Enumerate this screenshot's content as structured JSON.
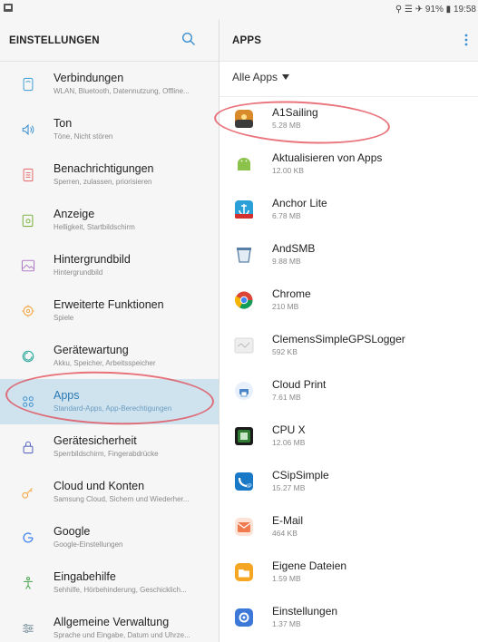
{
  "status_bar": {
    "text": "⚲ ☰ ✈ 91% ▮ 19:58"
  },
  "left_pane": {
    "title": "EINSTELLUNGEN",
    "items": [
      {
        "title": "Verbindungen",
        "subtitle": "WLAN, Bluetooth, Datennutzung, Offline...",
        "icon": "connections-icon"
      },
      {
        "title": "Ton",
        "subtitle": "Töne, Nicht stören",
        "icon": "sound-icon"
      },
      {
        "title": "Benachrichtigungen",
        "subtitle": "Sperren, zulassen, priorisieren",
        "icon": "notifications-icon"
      },
      {
        "title": "Anzeige",
        "subtitle": "Helligkeit, Startbildschirm",
        "icon": "display-icon"
      },
      {
        "title": "Hintergrundbild",
        "subtitle": "Hintergrundbild",
        "icon": "wallpaper-icon"
      },
      {
        "title": "Erweiterte Funktionen",
        "subtitle": "Spiele",
        "icon": "advanced-features-icon"
      },
      {
        "title": "Gerätewartung",
        "subtitle": "Akku, Speicher, Arbeitsspeicher",
        "icon": "device-maintenance-icon"
      },
      {
        "title": "Apps",
        "subtitle": "Standard-Apps, App-Berechtigungen",
        "icon": "apps-icon",
        "selected": true
      },
      {
        "title": "Gerätesicherheit",
        "subtitle": "Sperrbildschirm, Fingerabdrücke",
        "icon": "lock-icon"
      },
      {
        "title": "Cloud und Konten",
        "subtitle": "Samsung Cloud, Sichern und Wiederher...",
        "icon": "key-icon"
      },
      {
        "title": "Google",
        "subtitle": "Google-Einstellungen",
        "icon": "google-icon"
      },
      {
        "title": "Eingabehilfe",
        "subtitle": "Sehhilfe, Hörbehinderung, Geschicklich...",
        "icon": "accessibility-icon"
      },
      {
        "title": "Allgemeine Verwaltung",
        "subtitle": "Sprache und Eingabe, Datum und Uhrze...",
        "icon": "general-management-icon"
      }
    ]
  },
  "right_pane": {
    "title": "APPS",
    "filter_label": "Alle Apps",
    "apps": [
      {
        "name": "A1Sailing",
        "size": "5.28 MB",
        "icon": "a1sailing-icon",
        "color": "#d98a2b"
      },
      {
        "name": "Aktualisieren von Apps",
        "size": "12.00 KB",
        "icon": "android-icon",
        "color": "#8bc34a"
      },
      {
        "name": "Anchor Lite",
        "size": "6.78 MB",
        "icon": "anchor-icon",
        "color": "#2a9fd8"
      },
      {
        "name": "AndSMB",
        "size": "9.88 MB",
        "icon": "andsmb-icon",
        "color": "#5a7fa6"
      },
      {
        "name": "Chrome",
        "size": "210 MB",
        "icon": "chrome-icon",
        "color": "#db4437"
      },
      {
        "name": "ClemensSimpleGPSLogger",
        "size": "592 KB",
        "icon": "gps-logger-icon",
        "color": "#d8d8d8"
      },
      {
        "name": "Cloud Print",
        "size": "7.61 MB",
        "icon": "cloud-print-icon",
        "color": "#4a86c5"
      },
      {
        "name": "CPU X",
        "size": "12.06 MB",
        "icon": "cpu-icon",
        "color": "#2e7d32"
      },
      {
        "name": "CSipSimple",
        "size": "15.27 MB",
        "icon": "csipsimple-icon",
        "color": "#1a79c7"
      },
      {
        "name": "E-Mail",
        "size": "464 KB",
        "icon": "email-icon",
        "color": "#f07b4f"
      },
      {
        "name": "Eigene Dateien",
        "size": "1.59 MB",
        "icon": "my-files-icon",
        "color": "#f5a623"
      },
      {
        "name": "Einstellungen",
        "size": "1.37 MB",
        "icon": "settings-gear-icon",
        "color": "#3b78d8"
      }
    ]
  },
  "colors": {
    "selected_bg": "#cfe3ef",
    "accent": "#2b7ab3",
    "annotation": "#e24650"
  }
}
